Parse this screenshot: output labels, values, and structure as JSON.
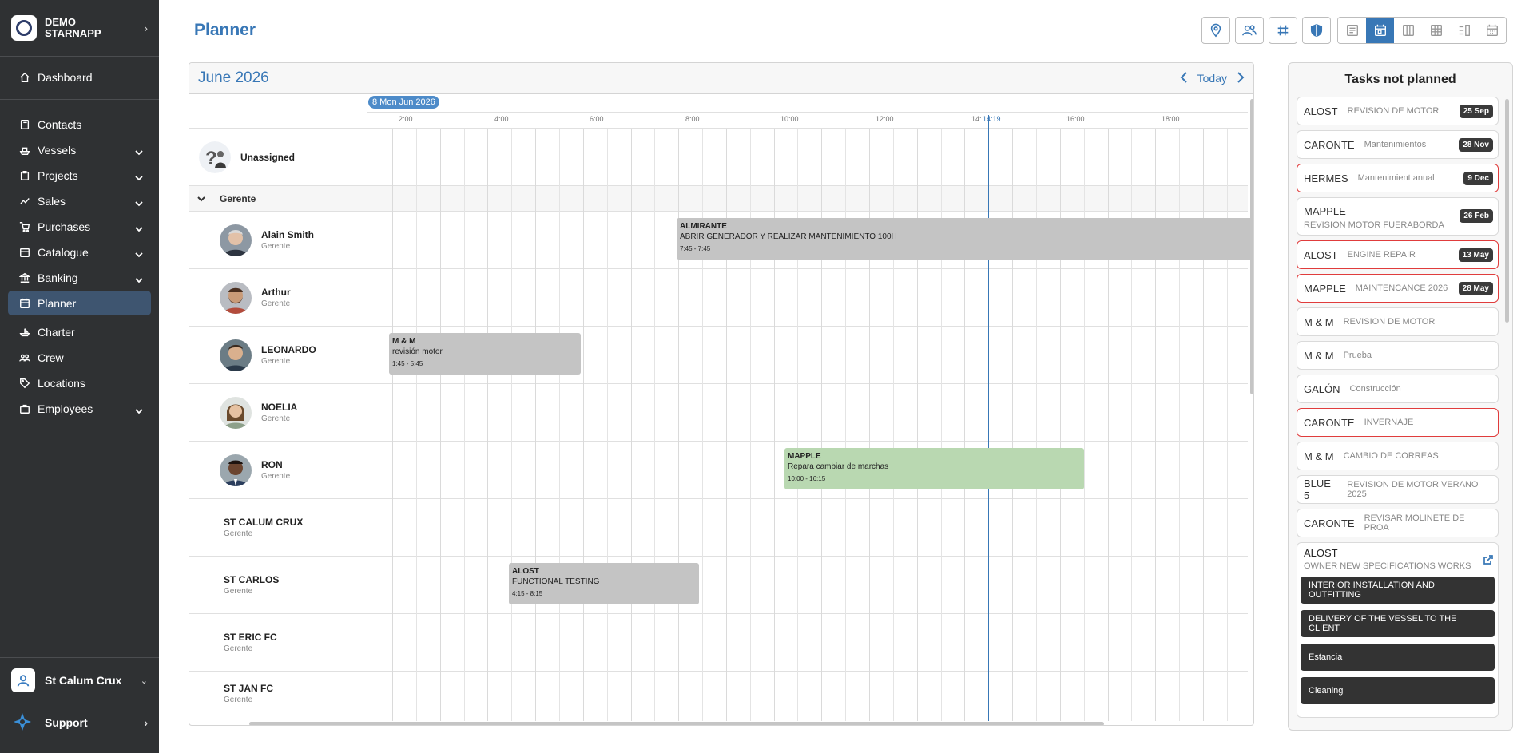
{
  "sidebar": {
    "brand": "DEMO STARNAPP",
    "items": [
      {
        "label": "Dashboard",
        "icon": "home-icon",
        "caret": false
      },
      {
        "label": "Contacts",
        "icon": "book-icon",
        "caret": false
      },
      {
        "label": "Vessels",
        "icon": "ship-icon",
        "caret": true
      },
      {
        "label": "Projects",
        "icon": "clipboard-icon",
        "caret": true
      },
      {
        "label": "Sales",
        "icon": "trend-icon",
        "caret": true
      },
      {
        "label": "Purchases",
        "icon": "cart-icon",
        "caret": true
      },
      {
        "label": "Catalogue",
        "icon": "catalogue-icon",
        "caret": true
      },
      {
        "label": "Banking",
        "icon": "bank-icon",
        "caret": true
      },
      {
        "label": "Planner",
        "icon": "calendar-icon",
        "caret": false,
        "active": true
      },
      {
        "label": "Charter",
        "icon": "charter-icon",
        "caret": false
      },
      {
        "label": "Crew",
        "icon": "crew-icon",
        "caret": false
      },
      {
        "label": "Locations",
        "icon": "tag-icon",
        "caret": false
      },
      {
        "label": "Employees",
        "icon": "briefcase-icon",
        "caret": true
      }
    ],
    "user": "St Calum Crux",
    "support": "Support"
  },
  "page": {
    "title": "Planner",
    "toolbar_icons": [
      "location-icon",
      "users-icon",
      "hash-icon",
      "shield-icon"
    ],
    "view_icons": [
      "list-view-icon",
      "calendar-view-icon",
      "columns-view-icon",
      "grid-view-icon",
      "split-view-icon",
      "month-view-icon"
    ]
  },
  "planner": {
    "month": "June 2026",
    "today": "Today",
    "date_chip": "8 Mon Jun 2026",
    "hours": [
      "2:00",
      "4:00",
      "6:00",
      "8:00",
      "10:00",
      "12:00",
      "14:",
      "16:00",
      "18:00"
    ],
    "now_label": "14:19",
    "unassigned": "Unassigned",
    "group": "Gerente",
    "people": [
      {
        "name": "Alain Smith",
        "role": "Gerente",
        "avatar": true
      },
      {
        "name": "Arthur",
        "role": "Gerente",
        "avatar": true
      },
      {
        "name": "LEONARDO",
        "role": "Gerente",
        "avatar": true
      },
      {
        "name": "NOELIA",
        "role": "Gerente",
        "avatar": true
      },
      {
        "name": "RON",
        "role": "Gerente",
        "avatar": true
      },
      {
        "name": "ST CALUM CRUX",
        "role": "Gerente",
        "avatar": false
      },
      {
        "name": "ST CARLOS",
        "role": "Gerente",
        "avatar": false
      },
      {
        "name": "ST ERIC FC",
        "role": "Gerente",
        "avatar": false
      },
      {
        "name": "ST JAN FC",
        "role": "Gerente",
        "avatar": false
      }
    ],
    "tasks": [
      {
        "vessel": "ALMIRANTE",
        "desc": "ABRIR GENERADOR Y REALIZAR MANTENIMIENTO 100H",
        "time": "7:45 - 7:45",
        "color": "#c4c4c4"
      },
      {
        "vessel": "M & M",
        "desc": "revisión motor",
        "time": "1:45 - 5:45",
        "color": "#c4c4c4"
      },
      {
        "vessel": "MAPPLE",
        "desc": "Repara cambiar de marchas",
        "time": "10:00 - 16:15",
        "color": "#b9d8b1"
      },
      {
        "vessel": "ALOST",
        "desc": "FUNCTIONAL TESTING",
        "time": "4:15 - 8:15",
        "color": "#c4c4c4"
      }
    ]
  },
  "tasks_panel": {
    "title": "Tasks not planned",
    "items": [
      {
        "vessel": "ALOST",
        "desc": "REVISION DE MOTOR",
        "badge": "25 Sep",
        "red": false,
        "two": false
      },
      {
        "vessel": "CARONTE",
        "desc": "Mantenimientos",
        "badge": "28 Nov",
        "red": false,
        "two": false
      },
      {
        "vessel": "HERMES",
        "desc": "Mantenimient anual",
        "badge": "9 Dec",
        "red": true,
        "two": false
      },
      {
        "vessel": "MAPPLE",
        "desc": "REVISION MOTOR FUERABORDA",
        "badge": "26 Feb",
        "red": false,
        "two": true
      },
      {
        "vessel": "ALOST",
        "desc": "ENGINE REPAIR",
        "badge": "13 May",
        "red": true,
        "two": false
      },
      {
        "vessel": "MAPPLE",
        "desc": "MAINTENCANCE 2026",
        "badge": "28 May",
        "red": true,
        "two": false
      },
      {
        "vessel": "M & M",
        "desc": "REVISION DE MOTOR",
        "badge": "",
        "red": false,
        "two": false
      },
      {
        "vessel": "M & M",
        "desc": "Prueba",
        "badge": "",
        "red": false,
        "two": false
      },
      {
        "vessel": "GALÓN",
        "desc": "Construcción",
        "badge": "",
        "red": false,
        "two": false
      },
      {
        "vessel": "CARONTE",
        "desc": "INVERNAJE",
        "badge": "",
        "red": true,
        "two": false
      },
      {
        "vessel": "M & M",
        "desc": "CAMBIO DE CORREAS",
        "badge": "",
        "red": false,
        "two": false
      },
      {
        "vessel": "BLUE 5",
        "desc": "REVISION DE MOTOR VERANO 2025",
        "badge": "",
        "red": false,
        "two": false
      },
      {
        "vessel": "CARONTE",
        "desc": "REVISAR MOLINETE DE PROA",
        "badge": "",
        "red": false,
        "two": false
      }
    ],
    "group": {
      "vessel": "ALOST",
      "desc": "OWNER NEW SPECIFICATIONS WORKS",
      "subtasks": [
        "INTERIOR INSTALLATION AND OUTFITTING",
        "DELIVERY OF THE VESSEL TO THE CLIENT",
        "Estancia",
        "Cleaning"
      ]
    }
  },
  "colors": {
    "accent": "#3877b6",
    "sidebar_bg": "#2f3133",
    "active_bg": "#3e5570",
    "overdue": "#e03c3c"
  }
}
